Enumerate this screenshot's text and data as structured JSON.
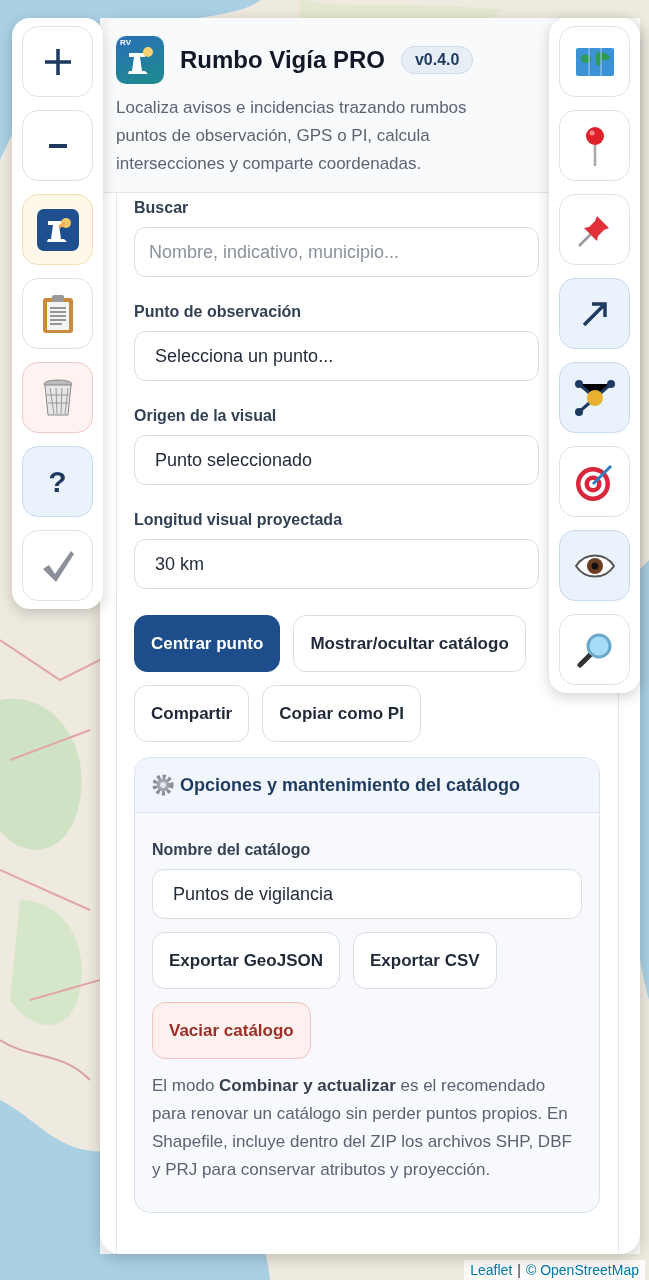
{
  "left_toolbar": [
    {
      "kind": "neutral"
    },
    {
      "kind": "neutral"
    },
    {
      "kind": "highlight"
    },
    {
      "kind": "neutral"
    },
    {
      "kind": "danger"
    },
    {
      "kind": "info",
      "label": "?"
    },
    {
      "kind": "neutral"
    }
  ],
  "right_toolbar": [
    {
      "active": false
    },
    {
      "active": false
    },
    {
      "active": false
    },
    {
      "active": true
    },
    {
      "active": true
    },
    {
      "active": false
    },
    {
      "active": true
    },
    {
      "active": false
    }
  ],
  "header": {
    "logo_text": "RV",
    "title": "Rumbo Vigía PRO",
    "version": "v0.4.0",
    "description": "Localiza avisos e incidencias trazando rumbos puntos de observación, GPS o PI, calcula intersecciones y comparte coordenadas."
  },
  "form": {
    "fields": [
      {
        "label": "Buscar",
        "kind": "input",
        "placeholder": "Nombre, indicativo, municipio..."
      },
      {
        "label": "Punto de observación",
        "kind": "select",
        "value": "Selecciona un punto..."
      },
      {
        "label": "Origen de la visual",
        "kind": "select",
        "value": "Punto seleccionado"
      },
      {
        "label": "Longitud visual proyectada",
        "kind": "select",
        "value": "30 km"
      }
    ],
    "button_rows": [
      [
        {
          "label": "Centrar punto",
          "kind": "primary"
        },
        {
          "label": "Mostrar/ocultar catálogo",
          "kind": "default"
        }
      ],
      [
        {
          "label": "Compartir",
          "kind": "default"
        },
        {
          "label": "Copiar como PI",
          "kind": "default"
        }
      ]
    ]
  },
  "catalog": {
    "title": "Opciones y mantenimiento del catálogo",
    "name_label": "Nombre del catálogo",
    "name_value": "Puntos de vigilancia",
    "button_rows": [
      [
        {
          "label": "Exportar GeoJSON",
          "kind": "default"
        },
        {
          "label": "Exportar CSV",
          "kind": "default"
        }
      ],
      [
        {
          "label": "Vaciar catálogo",
          "kind": "danger"
        }
      ]
    ],
    "note": "El modo **Combinar y actualizar** es el recomendado para renovar un catálogo sin perder puntos propios. En Shapefile, incluye dentro del ZIP los archivos SHP, DBF y PRJ para conservar atributos y proyección."
  },
  "attribution": {
    "leaflet": "Leaflet",
    "separator": "|",
    "osm": "© OpenStreetMap"
  }
}
